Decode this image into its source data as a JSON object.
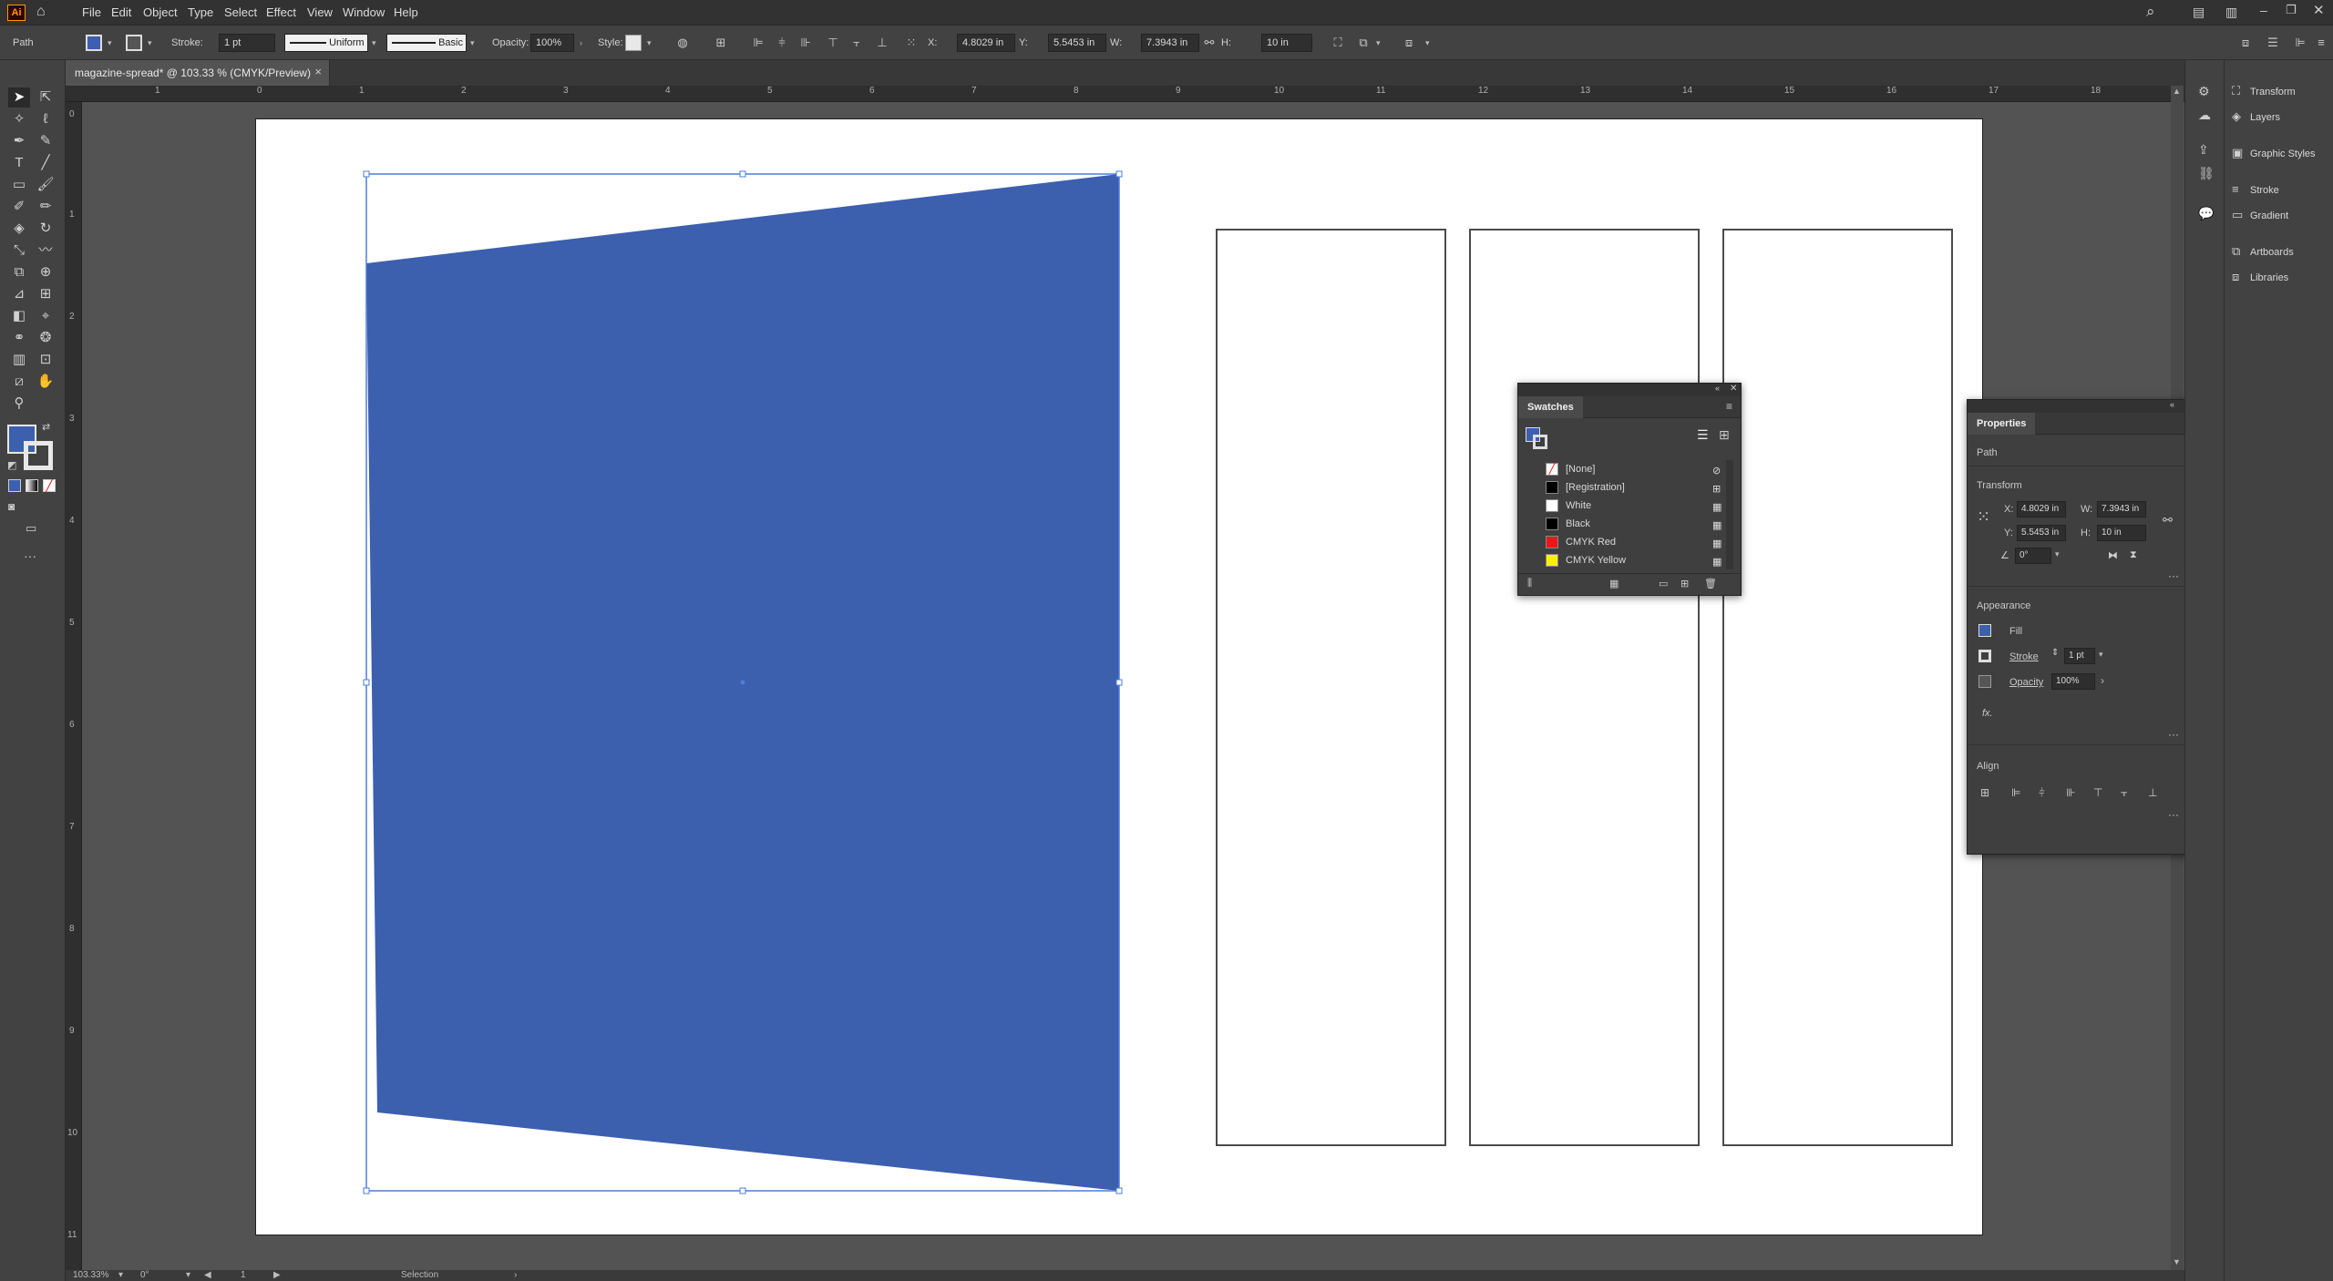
{
  "app": {
    "logo_text": "Ai",
    "menu": [
      "File",
      "Edit",
      "Object",
      "Type",
      "Select",
      "Effect",
      "View",
      "Window",
      "Help"
    ]
  },
  "control_bar": {
    "selection_type": "Path",
    "stroke_label": "Stroke:",
    "stroke_weight": "1 pt",
    "stroke_profile": "Uniform",
    "brush": "Basic",
    "opacity_label": "Opacity:",
    "opacity_value": "100%",
    "style_label": "Style:",
    "x_label": "X:",
    "x_value": "4.8029 in",
    "y_label": "Y:",
    "y_value": "5.5453 in",
    "w_label": "W:",
    "w_value": "7.3943 in",
    "h_label": "H:",
    "h_value": "10 in"
  },
  "document": {
    "tab_title": "magazine-spread* @ 103.33 % (CMYK/Preview)",
    "close_glyph": "×"
  },
  "rulers": {
    "h_ticks": [
      "1",
      "0",
      "1",
      "2",
      "3",
      "4",
      "5",
      "6",
      "7",
      "8",
      "9",
      "10",
      "11",
      "12",
      "13",
      "14",
      "15",
      "16",
      "17",
      "18"
    ],
    "v_ticks": [
      "0",
      "1",
      "2",
      "3",
      "4",
      "5",
      "6",
      "7",
      "8",
      "9",
      "10",
      "11"
    ]
  },
  "colors": {
    "fill_blue": "#3c5fae",
    "selection_blue": "#4e7ddb"
  },
  "swatches_panel": {
    "title": "Swatches",
    "items": [
      {
        "name": "[None]",
        "color": "#ffffff",
        "type_icon": "⊘"
      },
      {
        "name": "[Registration]",
        "color": "#000000",
        "type_icon": "⊞"
      },
      {
        "name": "White",
        "color": "#ffffff",
        "type_icon": "▦"
      },
      {
        "name": "Black",
        "color": "#000000",
        "type_icon": "▦"
      },
      {
        "name": "CMYK Red",
        "color": "#e21a1a",
        "type_icon": "▦"
      },
      {
        "name": "CMYK Yellow",
        "color": "#ffef00",
        "type_icon": "▦"
      }
    ]
  },
  "properties_panel": {
    "title": "Properties",
    "section_path": "Path",
    "section_transform": "Transform",
    "x_label": "X:",
    "x_value": "4.8029 in",
    "y_label": "Y:",
    "y_value": "5.5453 in",
    "w_label": "W:",
    "w_value": "7.3943 in",
    "h_label": "H:",
    "h_value": "10 in",
    "rotate_value": "0°",
    "section_appearance": "Appearance",
    "fill_label": "Fill",
    "stroke_label": "Stroke",
    "stroke_value": "1 pt",
    "opacity_label": "Opacity",
    "opacity_value": "100%",
    "fx_label": "fx.",
    "section_align": "Align"
  },
  "dock": {
    "items": [
      "Transform",
      "Layers",
      "Graphic Styles",
      "Stroke",
      "Gradient",
      "Artboards",
      "Libraries"
    ]
  },
  "status_bar": {
    "zoom": "103.33%",
    "rotation": "0°",
    "artboard_num": "1",
    "tool": "Selection"
  }
}
